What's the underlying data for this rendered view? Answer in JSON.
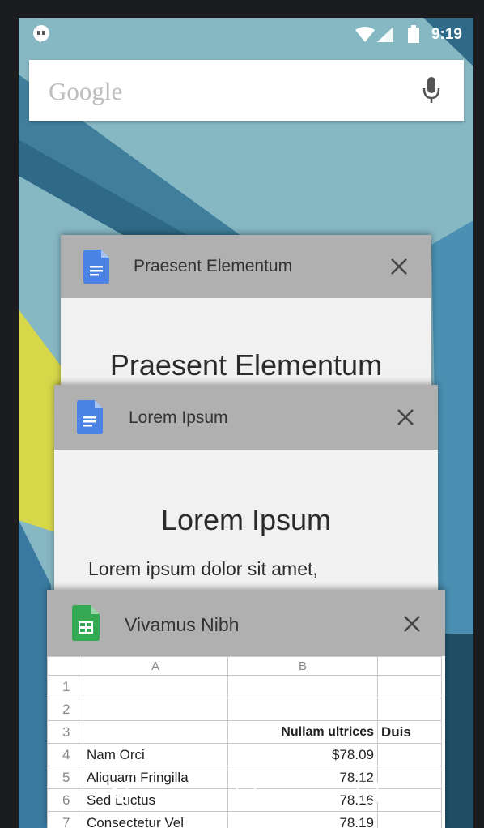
{
  "status_bar": {
    "time": "9:19"
  },
  "search": {
    "placeholder": "Google"
  },
  "cards": [
    {
      "title": "Praesent Elementum",
      "doc_heading": "Praesent Elementum",
      "app_icon": "docs-icon"
    },
    {
      "title": "Lorem Ipsum",
      "doc_heading": "Lorem Ipsum",
      "doc_text": "Lorem ipsum dolor sit amet,",
      "app_icon": "docs-icon"
    },
    {
      "title": "Vivamus Nibh",
      "app_icon": "sheets-icon",
      "sheet": {
        "col_headers": [
          "A",
          "B"
        ],
        "rows": [
          {
            "n": "1",
            "a": "",
            "b": "",
            "c": ""
          },
          {
            "n": "2",
            "a": "",
            "b": "",
            "c": ""
          },
          {
            "n": "3",
            "a": "",
            "b": "Nullam ultrices",
            "c": "Duis"
          },
          {
            "n": "4",
            "a": "Nam Orci",
            "b": "$78.09",
            "c": ""
          },
          {
            "n": "5",
            "a": "Aliquam Fringilla",
            "b": "78.12",
            "c": ""
          },
          {
            "n": "6",
            "a": "Sed Luctus",
            "b": "78.16",
            "c": ""
          },
          {
            "n": "7",
            "a": "Consectetur Vel",
            "b": "78.19",
            "c": ""
          }
        ]
      }
    }
  ],
  "navbar": {
    "back": "back-icon",
    "home": "home-icon",
    "recents": "recents-icon"
  },
  "colors": {
    "header_gray": "#b0b0b0",
    "docs_blue": "#4a83e4",
    "sheets_green": "#34a853",
    "wallpaper": "#7fb3c1"
  }
}
